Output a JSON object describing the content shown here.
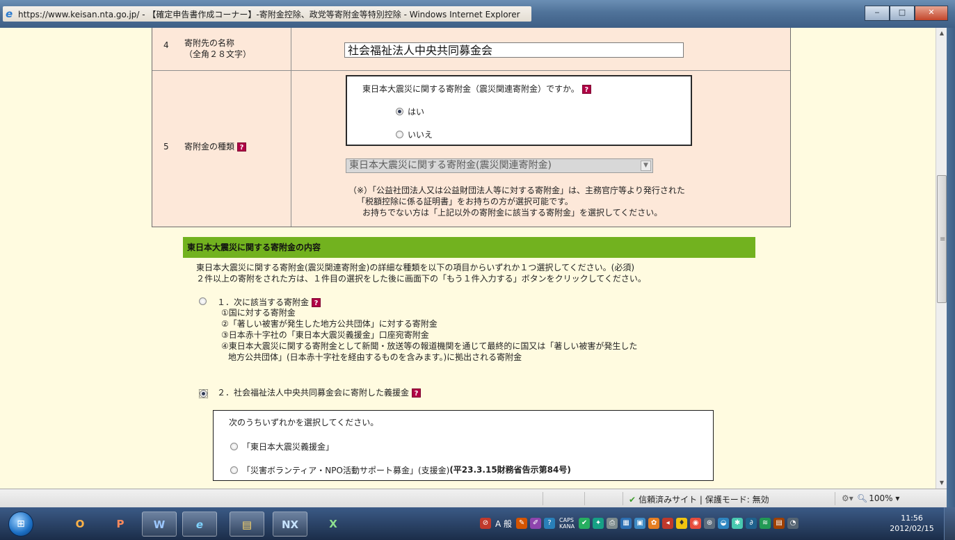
{
  "window": {
    "title": "https://www.keisan.nta.go.jp/ - 【確定申告書作成コーナー】-寄附金控除、政党等寄附金等特別控除 - Windows Internet Explorer",
    "min_label": "‒",
    "max_label": "□",
    "close_label": "✕"
  },
  "form": {
    "row4": {
      "num": "4",
      "label_line1": "寄附先の名称",
      "label_line2": "（全角２８文字）",
      "value": "社会福祉法人中央共同募金会"
    },
    "row5": {
      "num": "5",
      "label": "寄附金の種類",
      "quake_question": "東日本大震災に関する寄附金（震災関連寄附金）ですか。",
      "yes_label": "はい",
      "no_label": "いいえ",
      "select_value": "東日本大震災に関する寄附金(震災関連寄附金)",
      "note_line1": "（※）「公益社団法人又は公益財団法人等に対する寄附金」は、主務官庁等より発行された",
      "note_line2": "「税額控除に係る証明書」をお持ちの方が選択可能です。",
      "note_line3": "お持ちでない方は「上記以外の寄附金に該当する寄附金」を選択してください。"
    }
  },
  "section": {
    "header": "東日本大震災に関する寄附金の内容",
    "intro_line1": "東日本大震災に関する寄附金(震災関連寄附金)の詳細な種類を以下の項目からいずれか１つ選択してください。(必須)",
    "intro_line2": "２件以上の寄附をされた方は、１件目の選択をした後に画面下の「もう１件入力する」ボタンをクリックしてください。",
    "option1": {
      "label": "１．次に該当する寄附金",
      "items": [
        "①国に対する寄附金",
        "②「著しい被害が発生した地方公共団体」に対する寄附金",
        "③日本赤十字社の「東日本大震災義援金」口座宛寄附金",
        "④東日本大震災に関する寄附金として新聞・放送等の報道機関を通じて最終的に国又は「著しい被害が発生した",
        "地方公共団体」(日本赤十字社を経由するものを含みます。)に拠出される寄附金"
      ]
    },
    "option2": {
      "label": "２．社会福祉法人中央共同募金会に寄附した義援金",
      "sub_question": "次のうちいずれかを選択してください。",
      "sub_a": "「東日本大震災義援金」",
      "sub_b_main": "「災害ボランティア・NPO活動サポート募金」(支援金)",
      "sub_b_bold": "(平23.3.15財務省告示第84号)"
    }
  },
  "statusbar": {
    "trusted": "信頼済みサイト | 保護モード: 無効",
    "zoom": "100%"
  },
  "taskbar": {
    "apps": [
      "Outlook",
      "PowerPoint",
      "Word",
      "Internet Explorer",
      "Explorer",
      "NX",
      "Excel"
    ],
    "app_glyphs": [
      "O",
      "P",
      "W",
      "e",
      "▤",
      "NX",
      "X"
    ],
    "ime": "A 般",
    "caps": "CAPS",
    "kana": "KANA",
    "time": "11:56",
    "date": "2012/02/15"
  },
  "colors": {
    "page_bg": "#fffbe0",
    "form_bg": "#fde8d9",
    "section_green": "#72b21f",
    "help_icon": "#b00045"
  }
}
